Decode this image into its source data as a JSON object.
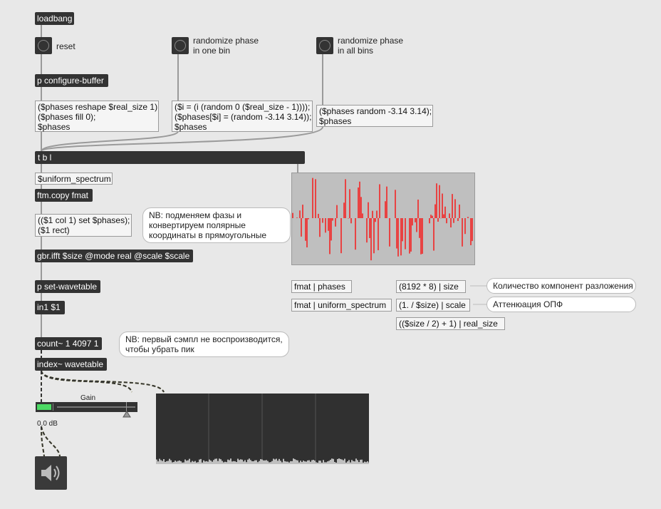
{
  "objects": {
    "loadbang": "loadbang",
    "configure_buffer": "p configure-buffer",
    "tbl": "t b l",
    "uniform_spectrum": "$uniform_spectrum",
    "ftm_copy": "ftm.copy fmat",
    "ifft": "gbr.ifft $size @mode real @scale $scale",
    "set_wavetable": "p set-wavetable",
    "in1": "in1 $1",
    "count": "count~ 1 4097 1",
    "index": "index~ wavetable"
  },
  "messages": {
    "reshape": "($phases reshape $real_size 1)\n($phases fill 0);\n$phases",
    "random_one": "($i = (i (random 0 ($real_size - 1))));\n($phases[$i] = (random -3.14 3.14));\n$phases",
    "random_all": "($phases random -3.14 3.14);\n$phases",
    "set_phases": "(($1 col 1) set $phases);\n($1 rect)",
    "fmat_phases": "fmat | phases",
    "fmat_uniform": "fmat | uniform_spectrum",
    "size": "(8192 * 8) | size",
    "scale": "(1. / $size) | scale",
    "real_size": "(($size / 2) + 1) | real_size"
  },
  "comments": {
    "reset": "reset",
    "rand_one": "randomize phase\nin one bin",
    "rand_all": "randomize phase\nin all bins",
    "nb_phases": "NB: подменяем фазы и\nконвертируем полярные\nкоординаты в прямоугольные",
    "nb_count": "NB: первый сэмпл не воспроизводится,\nчтобы убрать пик",
    "size_note": "Количество компонент разложения",
    "scale_note": "Аттенюация ОПФ",
    "gain_label": "Gain",
    "gain_value": "0.0 dB"
  },
  "colors": {
    "phase_bars": "#ff0000",
    "meter_green": "#4cd964",
    "patch_cord": "#999999",
    "signal_cord": "#c8c832"
  },
  "icons": {
    "bang": "bang-circle",
    "speaker": "speaker-icon"
  },
  "gain": {
    "level_db": 0.0
  }
}
